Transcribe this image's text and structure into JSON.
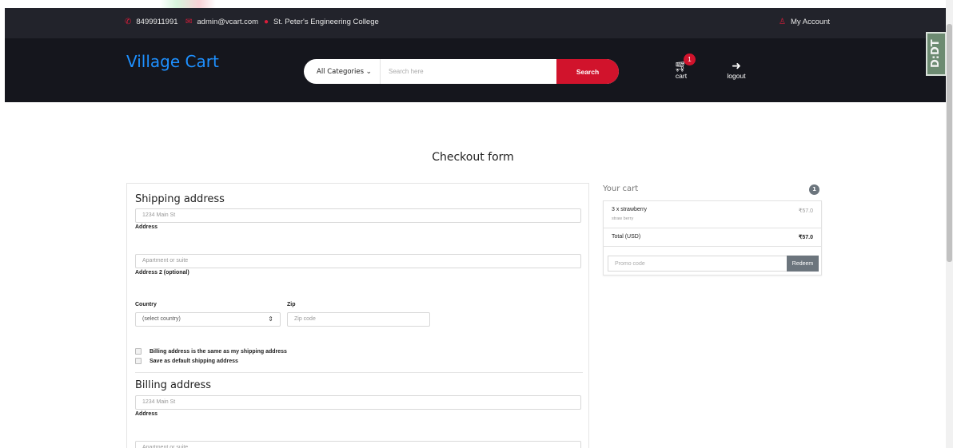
{
  "top_info": {
    "phone": "8499911991",
    "email": "admin@vcart.com",
    "location": "St. Peter's Engineering College",
    "account": "My Account"
  },
  "header": {
    "brand": "Village Cart",
    "category_selected": "All Categories",
    "search_placeholder": "Search here",
    "search_button": "Search",
    "cart_label": "cart",
    "cart_badge": "1",
    "logout_label": "logout"
  },
  "watermark": "D:DT",
  "page_title": "Checkout form",
  "shipping": {
    "title": "Shipping address",
    "address_placeholder": "1234 Main St",
    "address_label": "Address",
    "address2_placeholder": "Apartment or suite",
    "address2_label": "Address 2 (optional)",
    "country_label": "Country",
    "country_selected": "(select country)",
    "zip_label": "Zip",
    "zip_placeholder": "Zip code",
    "check_same": "Billing address is the same as my shipping address",
    "check_default": "Save as default shipping address"
  },
  "billing": {
    "title": "Billing address",
    "address_placeholder": "1234 Main St",
    "address_label": "Address",
    "address2_placeholder": "Apartment or suite"
  },
  "cart": {
    "title": "Your cart",
    "count": "1",
    "items": [
      {
        "name": "3 x strawberry",
        "desc": "straw berry",
        "price": "₹57.0"
      }
    ],
    "total_label": "Total (USD)",
    "total_value": "₹57.0",
    "promo_placeholder": "Promo code",
    "promo_button": "Redeem"
  },
  "colors": {
    "brand": "#1e90ff",
    "accent": "#d1132c",
    "header_bg": "#15161d",
    "infobar_bg": "#22232b"
  },
  "icons": {
    "phone": "phone-icon",
    "email": "envelope-icon",
    "location": "map-marker-icon",
    "account": "user-icon",
    "cart": "shopping-cart-icon",
    "logout": "sign-out-icon"
  }
}
